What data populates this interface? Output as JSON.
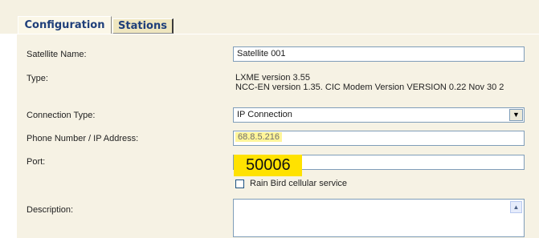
{
  "tabs": [
    {
      "label": "Configuration",
      "active": true
    },
    {
      "label": "Stations",
      "active": false
    }
  ],
  "form": {
    "satellite_name": {
      "label": "Satellite Name:",
      "value": "Satellite 001"
    },
    "type": {
      "label": "Type:",
      "line1": "LXME version 3.55",
      "line2": "NCC-EN version 1.35. CIC Modem Version VERSION 0.22 Nov 30 2"
    },
    "connection_type": {
      "label": "Connection Type:",
      "value": "IP Connection"
    },
    "phone_ip": {
      "label": "Phone Number / IP Address:",
      "value": "68.8.5.216"
    },
    "port": {
      "label": "Port:",
      "value": "50006"
    },
    "cellular": {
      "label": "Rain Bird cellular service",
      "checked": false
    },
    "description": {
      "label": "Description:",
      "value": ""
    }
  },
  "colors": {
    "highlight_yellow": "#ffe200",
    "ip_highlight": "#fff59a",
    "tab_text": "#1f3f7a",
    "panel_bg": "#f6f2e4"
  },
  "icons": {
    "dropdown": "chevron-down-icon",
    "scroll_up": "scroll-up-arrow-icon"
  }
}
